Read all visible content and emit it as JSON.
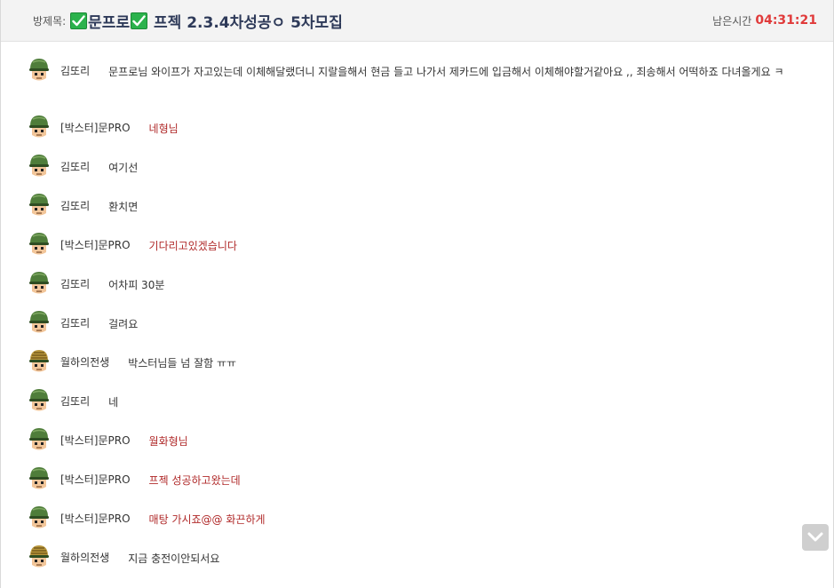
{
  "header": {
    "room_label": "방제목:",
    "title_part1": "문프로",
    "title_part2": " 프젝 2.3.4차성공ㅇ 5차모집",
    "timer_label": "남은시간",
    "timer_value": "04:31:21",
    "check_icon": "check-box-icon",
    "accent_color": "#e03a3a",
    "title_color": "#2e3a59"
  },
  "messages": [
    {
      "nick": "김또리",
      "text": "문프로님 와이프가 자고있는데 이체해달랬더니 지랄을해서 현금 들고 나가서 제카드에 입금해서 이체해야할거같아요 ,, 죄송해서 어떡하죠 다녀올게요 ㅋ",
      "avatar": "green"
    },
    {
      "nick": "[박스터]문PRO",
      "text": "네형님",
      "avatar": "green"
    },
    {
      "nick": "김또리",
      "text": "여기선",
      "avatar": "green"
    },
    {
      "nick": "김또리",
      "text": "환치면",
      "avatar": "green"
    },
    {
      "nick": "[박스터]문PRO",
      "text": "기다리고있겠습니다",
      "avatar": "green"
    },
    {
      "nick": "김또리",
      "text": "어차피 30분",
      "avatar": "green"
    },
    {
      "nick": "김또리",
      "text": "걸려요",
      "avatar": "green"
    },
    {
      "nick": "월하의전생",
      "text": "박스터님들 넘 잘함 ㅠㅠ",
      "avatar": "striped"
    },
    {
      "nick": "김또리",
      "text": "네",
      "avatar": "green"
    },
    {
      "nick": "[박스터]문PRO",
      "text": "월화형님",
      "avatar": "green"
    },
    {
      "nick": "[박스터]문PRO",
      "text": "프젝 성공하고왔는데",
      "avatar": "green"
    },
    {
      "nick": "[박스터]문PRO",
      "text": "매탕 가시죠@@ 화끈하게",
      "avatar": "green"
    },
    {
      "nick": "월하의전생",
      "text": "지금 충전이안되서요",
      "avatar": "striped"
    }
  ],
  "scroll_button_icon": "chevron-down-icon",
  "host_text_color": "#b02a2a"
}
